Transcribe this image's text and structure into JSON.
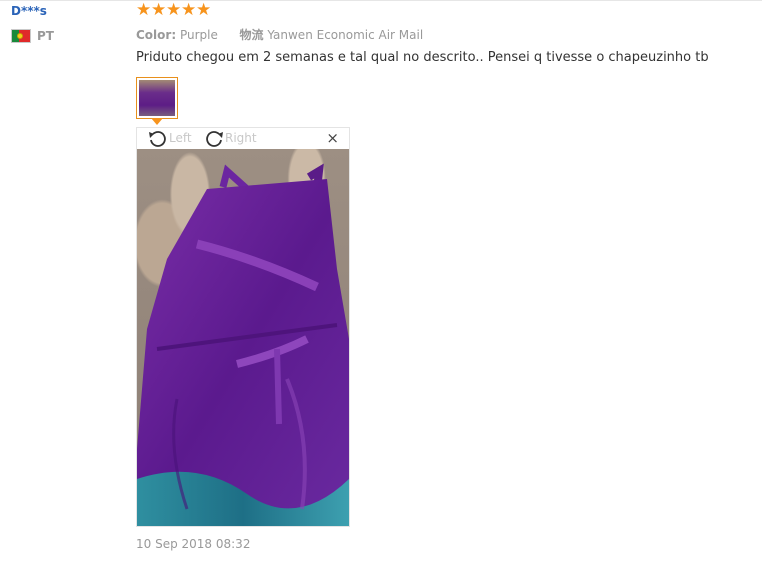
{
  "review": {
    "user_name": "D***s",
    "country_code": "PT",
    "rating": 5,
    "color_label": "Color:",
    "color_value": "Purple",
    "shipping_label": "物流",
    "shipping_value": "Yanwen Economic Air Mail",
    "text": "Priduto chegou em 2 semanas e tal qual no descrito.. Pensei q tivesse o chapeuzinho tb",
    "date": "10 Sep 2018 08:32"
  },
  "viewer": {
    "rotate_left_label": "Left",
    "rotate_right_label": "Right",
    "close_glyph": "×"
  },
  "icons": {
    "star": "star-icon",
    "rotate_left": "rotate-left-icon",
    "rotate_right": "rotate-right-icon",
    "close": "close-icon",
    "flag": "portugal-flag-icon"
  },
  "colors": {
    "user_link": "#2a63b8",
    "star": "#f7941d",
    "muted_text": "#999999",
    "thumb_border": "#e8901c"
  }
}
